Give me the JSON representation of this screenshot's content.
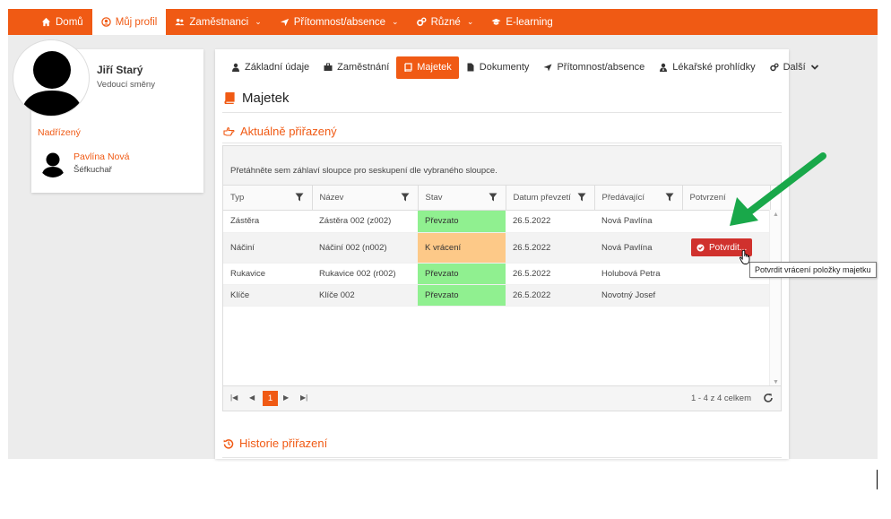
{
  "nav": {
    "items": [
      {
        "label": "Domů",
        "icon": "home-icon"
      },
      {
        "label": "Můj profil",
        "icon": "user-circle-icon",
        "active": true
      },
      {
        "label": "Zaměstnanci",
        "icon": "users-icon",
        "caret": "⌄"
      },
      {
        "label": "Přítomnost/absence",
        "icon": "plane-icon",
        "caret": "⌄"
      },
      {
        "label": "Různé",
        "icon": "cogs-icon",
        "caret": "⌄"
      },
      {
        "label": "E-learning",
        "icon": "graduation-cap-icon"
      }
    ]
  },
  "profile": {
    "name": "Jiří Starý",
    "role": "Vedoucí směny",
    "supervisor_label": "Nadřízený",
    "supervisor_name": "Pavlína Nová",
    "supervisor_role": "Šéfkuchař"
  },
  "tabs": [
    {
      "label": "Základní údaje",
      "icon": "user-icon"
    },
    {
      "label": "Zaměstnání",
      "icon": "briefcase-icon"
    },
    {
      "label": "Majetek",
      "icon": "book-icon",
      "active": true
    },
    {
      "label": "Dokumenty",
      "icon": "file-icon"
    },
    {
      "label": "Přítomnost/absence",
      "icon": "plane-icon"
    },
    {
      "label": "Lékařské prohlídky",
      "icon": "user-md-icon"
    },
    {
      "label": "Další",
      "icon": "cogs-icon"
    }
  ],
  "section": {
    "title": "Majetek",
    "current_title": "Aktuálně přiřazený",
    "history_title": "Historie přiřazení"
  },
  "grid": {
    "group_hint": "Přetáhněte sem záhlaví sloupce pro seskupení dle vybraného sloupce.",
    "columns": [
      "Typ",
      "Název",
      "Stav",
      "Datum převzetí",
      "Předávající",
      "Potvrzení"
    ],
    "rows": [
      {
        "typ": "Zástěra",
        "nazev": "Zástěra 002 (z002)",
        "stav": "Převzato",
        "datum": "26.5.2022",
        "predavajici": "Nová Pavlína"
      },
      {
        "typ": "Náčiní",
        "nazev": "Náčiní 002 (n002)",
        "stav": "K vrácení",
        "datum": "26.5.2022",
        "predavajici": "Nová Pavlína",
        "action": "Potvrdit..."
      },
      {
        "typ": "Rukavice",
        "nazev": "Rukavice 002 (r002)",
        "stav": "Převzato",
        "datum": "26.5.2022",
        "predavajici": "Holubová Petra"
      },
      {
        "typ": "Klíče",
        "nazev": "Klíče 002",
        "stav": "Převzato",
        "datum": "26.5.2022",
        "predavajici": "Novotný Josef"
      }
    ],
    "pager": {
      "current_page": "1",
      "summary": "1 - 4 z 4 celkem"
    }
  },
  "tooltip": "Potvrdit vrácení položky majetku",
  "colors": {
    "accent": "#f05a14",
    "taken": "#90f090",
    "to_return": "#fdc988",
    "confirm": "#d0312d",
    "arrow": "#19a84a"
  }
}
